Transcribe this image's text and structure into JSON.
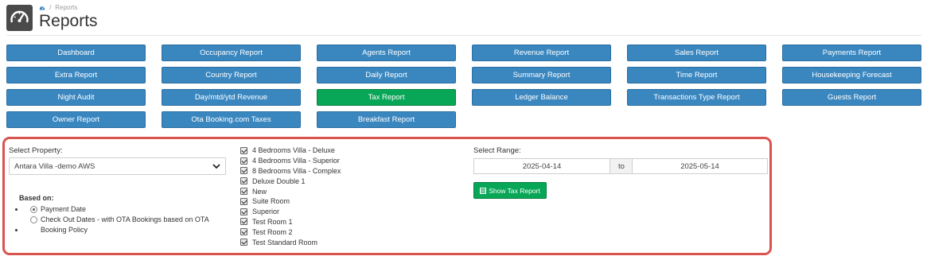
{
  "breadcrumb": {
    "home_icon": "dashboard-icon",
    "current": "Reports"
  },
  "page": {
    "title": "Reports"
  },
  "report_buttons": [
    {
      "label": "Dashboard"
    },
    {
      "label": "Occupancy Report"
    },
    {
      "label": "Agents Report"
    },
    {
      "label": "Revenue Report"
    },
    {
      "label": "Sales Report"
    },
    {
      "label": "Payments Report"
    },
    {
      "label": "Extra Report"
    },
    {
      "label": "Country Report"
    },
    {
      "label": "Daily Report"
    },
    {
      "label": "Summary Report"
    },
    {
      "label": "Time Report"
    },
    {
      "label": "Housekeeping Forecast"
    },
    {
      "label": "Night Audit"
    },
    {
      "label": "Day/mtd/ytd Revenue"
    },
    {
      "label": "Tax Report",
      "active": true
    },
    {
      "label": "Ledger Balance"
    },
    {
      "label": "Transactions Type Report"
    },
    {
      "label": "Guests Report"
    },
    {
      "label": "Owner Report"
    },
    {
      "label": "Ota Booking.com Taxes"
    },
    {
      "label": "Breakfast Report"
    }
  ],
  "filter": {
    "property_label": "Select Property:",
    "property_value": "Antara Villa -demo AWS",
    "based_on_label": "Based on:",
    "based_on_options": [
      {
        "label": "Payment Date",
        "selected": true
      },
      {
        "label": "Check Out Dates - with OTA Bookings based on OTA Booking Policy",
        "selected": false
      }
    ],
    "rooms": [
      {
        "label": "4 Bedrooms Villa - Deluxe",
        "checked": true
      },
      {
        "label": "4 Bedrooms Villa - Superior",
        "checked": true
      },
      {
        "label": "8 Bedrooms Villa - Complex",
        "checked": true
      },
      {
        "label": "Deluxe Double 1",
        "checked": true
      },
      {
        "label": "New",
        "checked": true
      },
      {
        "label": "Suite Room",
        "checked": true
      },
      {
        "label": "Superior",
        "checked": true
      },
      {
        "label": "Test Room 1",
        "checked": true
      },
      {
        "label": "Test Room 2",
        "checked": true
      },
      {
        "label": "Test Standard Room",
        "checked": true
      }
    ],
    "range_label": "Select Range:",
    "date_from": "2025-04-14",
    "to_label": "to",
    "date_to": "2025-05-14",
    "show_button": "Show Tax Report"
  },
  "colors": {
    "primary_button": "#3a87c0",
    "active_button": "#08a657",
    "panel_border": "#d9534f"
  }
}
